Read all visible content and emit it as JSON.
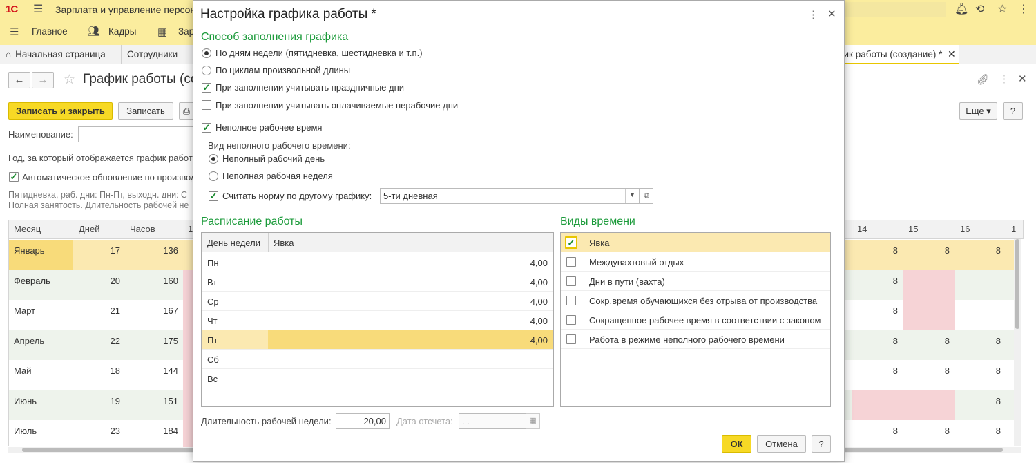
{
  "app": {
    "title": "Зарплата и управление персонал"
  },
  "menu": {
    "items": [
      "Главное",
      "Кадры",
      "Зар"
    ]
  },
  "tabs": [
    {
      "label": "Начальная страница"
    },
    {
      "label": "Сотрудники"
    },
    {
      "label": "рик работы (создание) *"
    }
  ],
  "document": {
    "title": "График работы (со",
    "save_close": "Записать и закрыть",
    "save": "Записать",
    "more": "Еще",
    "help": "?",
    "name_label": "Наименование:",
    "year_label": "Год, за который отображается график работ",
    "auto_update": "Автоматическое обновление по производ",
    "desc1": "Пятидневка, раб. дни: Пн-Пт, выходн. дни: С",
    "desc2": "Полная занятость. Длительность рабочей не"
  },
  "grid": {
    "headers": {
      "month": "Месяц",
      "days": "Дней",
      "hours": "Часов",
      "d1": "1",
      "d14": "14",
      "d15": "15",
      "d16": "16",
      "d17": "1"
    },
    "rows": [
      {
        "month": "Январь",
        "days": "17",
        "hours": "136",
        "c14": "8",
        "c15": "8",
        "c16": "8"
      },
      {
        "month": "Февраль",
        "days": "20",
        "hours": "160",
        "c14": "8",
        "c15": "",
        "c16": ""
      },
      {
        "month": "Март",
        "days": "21",
        "hours": "167",
        "c14": "8",
        "c15": "",
        "c16": ""
      },
      {
        "month": "Апрель",
        "days": "22",
        "hours": "175",
        "c14": "8",
        "c15": "8",
        "c16": "8"
      },
      {
        "month": "Май",
        "days": "18",
        "hours": "144",
        "c14": "8",
        "c15": "8",
        "c16": "8"
      },
      {
        "month": "Июнь",
        "days": "19",
        "hours": "151",
        "c14": "",
        "c15": "",
        "c16": "8"
      },
      {
        "month": "Июль",
        "days": "23",
        "hours": "184",
        "c14": "8",
        "c15": "8",
        "c16": "8"
      }
    ]
  },
  "modal": {
    "title": "Настройка графика работы *",
    "fill_method_title": "Способ заполнения графика",
    "opt_weekdays": "По дням недели (пятидневка, шестидневка и т.п.)",
    "opt_cycles": "По циклам произвольной длины",
    "chk_holidays": "При заполнении учитывать праздничные дни",
    "chk_paid_nonwork": "При заполнении учитывать оплачиваемые нерабочие дни",
    "chk_parttime": "Неполное рабочее время",
    "parttime_kind_label": "Вид неполного рабочего времени:",
    "opt_partday": "Неполный рабочий день",
    "opt_partweek": "Неполная рабочая неделя",
    "chk_norm_other": "Считать норму по другому графику:",
    "norm_schedule": "5-ти дневная",
    "schedule_title": "Расписание работы",
    "schedule_head_day": "День недели",
    "schedule_head_presence": "Явка",
    "schedule": [
      {
        "day": "Пн",
        "value": "4,00"
      },
      {
        "day": "Вт",
        "value": "4,00"
      },
      {
        "day": "Ср",
        "value": "4,00"
      },
      {
        "day": "Чт",
        "value": "4,00"
      },
      {
        "day": "Пт",
        "value": "4,00"
      },
      {
        "day": "Сб",
        "value": ""
      },
      {
        "day": "Вс",
        "value": ""
      }
    ],
    "time_kinds_title": "Виды времени",
    "time_kinds": [
      {
        "label": "Явка",
        "checked": true
      },
      {
        "label": "Междувахтовый отдых",
        "checked": false
      },
      {
        "label": "Дни в пути (вахта)",
        "checked": false
      },
      {
        "label": "Сокр.время обучающихся без отрыва от производства",
        "checked": false
      },
      {
        "label": "Сокращенное рабочее время в соответствии с законом",
        "checked": false
      },
      {
        "label": "Работа в режиме неполного рабочего времени",
        "checked": false
      }
    ],
    "week_length_label": "Длительность рабочей недели:",
    "week_length": "20,00",
    "date_label": "Дата отсчета:",
    "date_value": " .  .",
    "ok": "ОК",
    "cancel": "Отмена",
    "help": "?"
  },
  "colors": {
    "accent_yellow": "#f7d925",
    "topbar": "#fbed9e",
    "green_title": "#1c9b3b",
    "pink": "#f6d3d6",
    "row_highlight": "#fbe9b1"
  }
}
